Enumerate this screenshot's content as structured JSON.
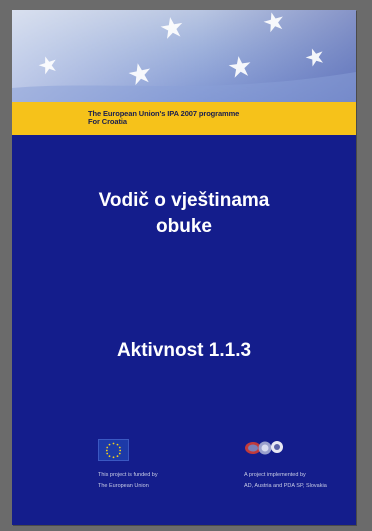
{
  "banner": {
    "programme_line1": "The European Union's IPA 2007 programme",
    "programme_line2": "For Croatia"
  },
  "cover": {
    "title_line1": "Vodič o vještinama",
    "title_line2": "obuke",
    "subtitle": "Aktivnost 1.1.3"
  },
  "footer": {
    "funded_line1": "This project is funded by",
    "funded_line2": "The European Union",
    "implemented_line1": "A project implemented by",
    "implemented_line2": "AD, Austria and PDA SP, Slovakia"
  },
  "colors": {
    "cover_background": "#141d8c",
    "strip": "#f6c21a",
    "frame": "#6b6b6b",
    "text": "#ffffff"
  },
  "icons": [
    "eu-flag-icon",
    "star-icon",
    "partner-logos-icon"
  ]
}
